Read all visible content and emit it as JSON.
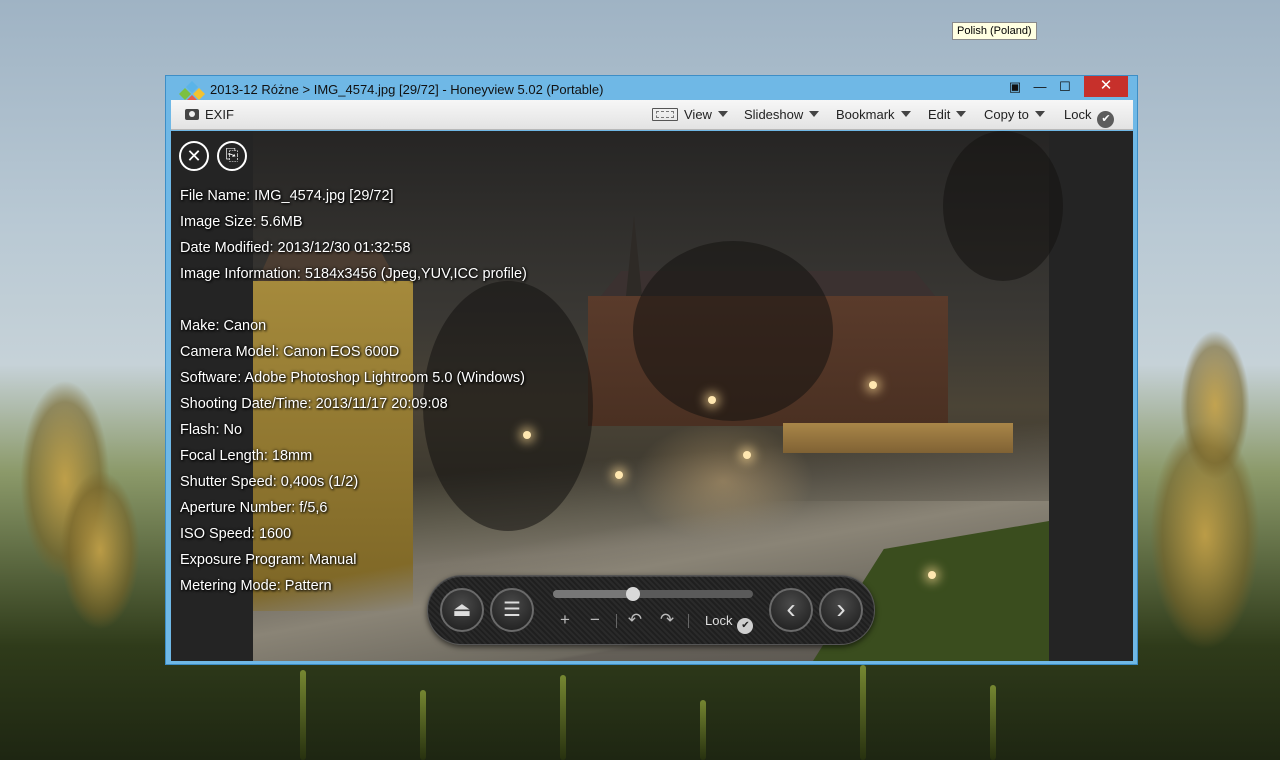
{
  "desktop": {
    "language_tooltip": "Polish (Poland)"
  },
  "window": {
    "title": "2013-12 Różne > IMG_4574.jpg [29/72] - Honeyview 5.02 (Portable)",
    "controls": {
      "fullscreen": "▣",
      "minimize": "—",
      "maximize": "☐",
      "close": "✕"
    }
  },
  "toolbar": {
    "exif_label": "EXIF",
    "view_label": "View",
    "slideshow_label": "Slideshow",
    "bookmark_label": "Bookmark",
    "edit_label": "Edit",
    "copy_to_label": "Copy to",
    "lock_label": "Lock"
  },
  "overlay": {
    "close_glyph": "✕",
    "copy_glyph": "⎘"
  },
  "exif": {
    "file_name": "File Name: IMG_4574.jpg [29/72]",
    "image_size": "Image Size: 5.6MB",
    "date_modified": "Date Modified: 2013/12/30 01:32:58",
    "image_information": "Image Information: 5184x3456 (Jpeg,YUV,ICC profile)",
    "make": "Make: Canon",
    "camera_model": "Camera Model: Canon EOS 600D",
    "software": "Software: Adobe Photoshop Lightroom 5.0 (Windows)",
    "shooting_datetime": "Shooting Date/Time: 2013/11/17 20:09:08",
    "flash": "Flash: No",
    "focal_length": "Focal Length: 18mm",
    "shutter_speed": "Shutter Speed: 0,400s (1/2)",
    "aperture": "Aperture Number: f/5,6",
    "iso": "ISO Speed: 1600",
    "exposure_program": "Exposure Program: Manual",
    "metering_mode": "Metering Mode: Pattern"
  },
  "control_bar": {
    "eject_glyph": "⏏",
    "menu_glyph": "☰",
    "zoom_in_glyph": "+",
    "zoom_out_glyph": "−",
    "rotate_left_glyph": "↶",
    "rotate_right_glyph": "↷",
    "lock_label": "Lock",
    "prev_glyph": "‹",
    "next_glyph": "›",
    "slider_position": 0.4
  },
  "icons": {
    "check": "✔"
  },
  "colors": {
    "title_bar": "#6fb8e6",
    "close_button": "#c7302b",
    "viewer_bg": "#242424",
    "tooltip_bg": "#ffffe1"
  }
}
